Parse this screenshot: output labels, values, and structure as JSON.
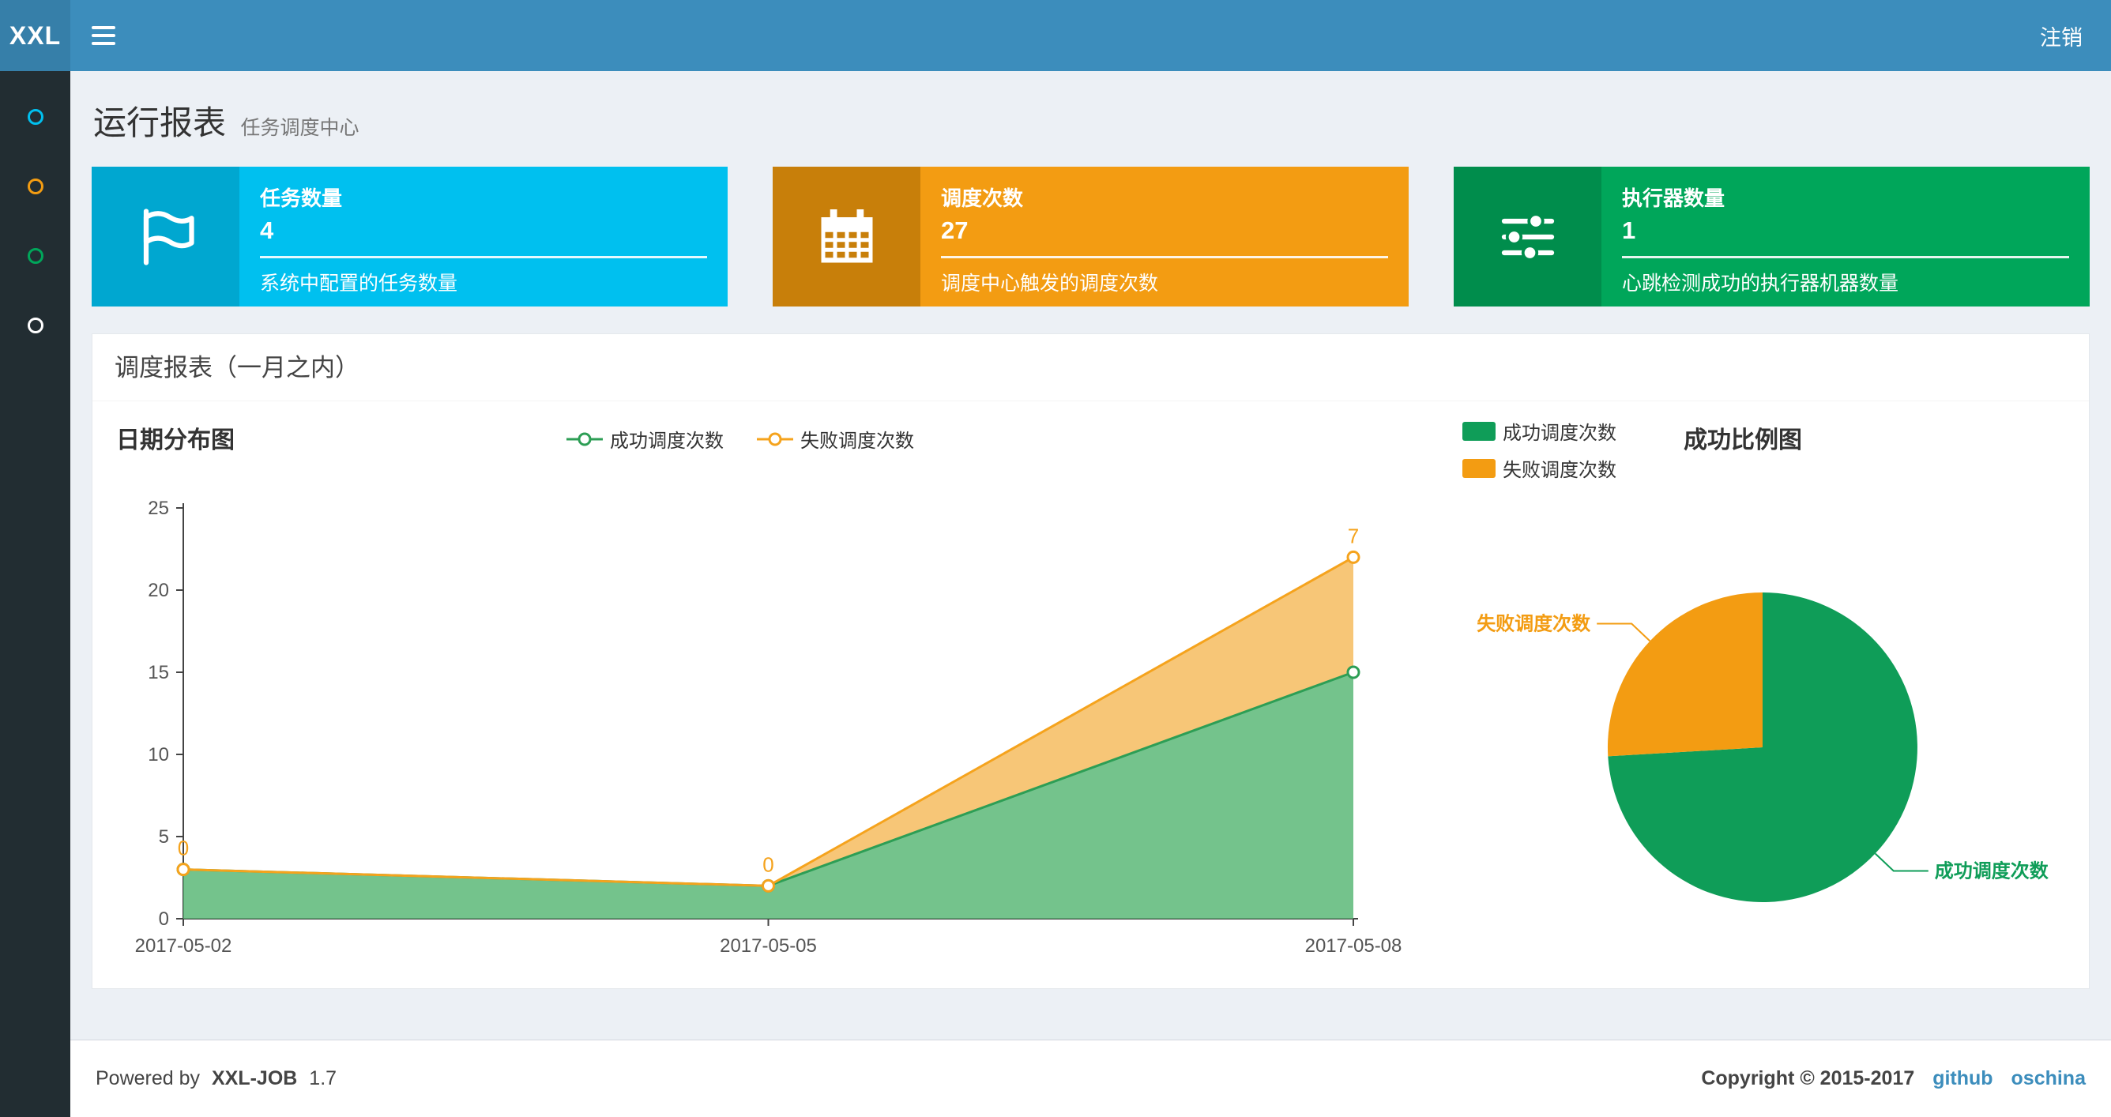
{
  "navbar": {
    "logo": "XXL",
    "logout": "注销"
  },
  "sidebar": {
    "items": [
      {
        "icon": "circle-icon",
        "color": "#00c0ef"
      },
      {
        "icon": "circle-icon",
        "color": "#f39c12"
      },
      {
        "icon": "circle-icon",
        "color": "#00a65a"
      },
      {
        "icon": "circle-icon",
        "color": "#ffffff"
      }
    ]
  },
  "page_header": {
    "title": "运行报表",
    "subtitle": "任务调度中心"
  },
  "info_boxes": [
    {
      "label": "任务数量",
      "value": "4",
      "desc": "系统中配置的任务数量",
      "bg": "#00c0ef",
      "icon_bg": "#00a7d0",
      "icon": "flag-icon"
    },
    {
      "label": "调度次数",
      "value": "27",
      "desc": "调度中心触发的调度次数",
      "bg": "#f39c12",
      "icon_bg": "#c87f0a",
      "icon": "calendar-icon"
    },
    {
      "label": "执行器数量",
      "value": "1",
      "desc": "心跳检测成功的执行器机器数量",
      "bg": "#00a65a",
      "icon_bg": "#008d4c",
      "icon": "sliders-icon"
    }
  ],
  "panel": {
    "title": "调度报表（一月之内）"
  },
  "chart_data": [
    {
      "type": "area",
      "title": "日期分布图",
      "stacked": true,
      "x": [
        "2017-05-02",
        "2017-05-05",
        "2017-05-08"
      ],
      "series": [
        {
          "name": "成功调度次数",
          "values": [
            3,
            2,
            15
          ],
          "color": "#2d9e55",
          "fill": "rgba(92,184,120,0.85)"
        },
        {
          "name": "失败调度次数",
          "values": [
            0,
            0,
            7
          ],
          "color": "#f5a31d",
          "fill": "rgba(246,190,100,0.88)",
          "point_labels": [
            "0",
            "0",
            "7"
          ]
        }
      ],
      "ylim": [
        0,
        25
      ],
      "yticks": [
        0,
        5,
        10,
        15,
        20,
        25
      ],
      "legend_position": "top",
      "grid": false
    },
    {
      "type": "pie",
      "title": "成功比例图",
      "slices": [
        {
          "name": "成功调度次数",
          "value": 20,
          "color": "#0f9d58"
        },
        {
          "name": "失败调度次数",
          "value": 7,
          "color": "#f39c12"
        }
      ],
      "legend_position": "top-left"
    }
  ],
  "footer": {
    "powered_prefix": "Powered by",
    "product": "XXL-JOB",
    "version": "1.7",
    "copyright": "Copyright © 2015-2017",
    "links": [
      "github",
      "oschina"
    ]
  }
}
